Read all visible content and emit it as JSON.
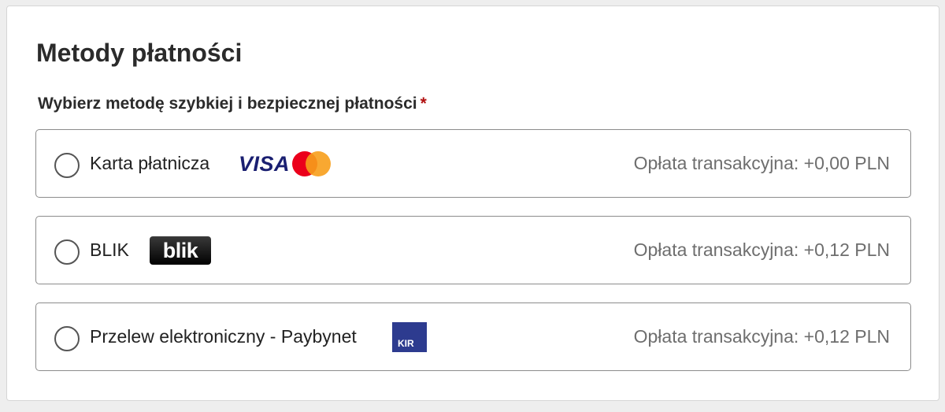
{
  "header": {
    "title": "Metody płatności",
    "subtitle": "Wybierz metodę szybkiej i bezpiecznej płatności",
    "required_mark": "*"
  },
  "options": [
    {
      "label": "Karta płatnicza",
      "fee": "Opłata transakcyjna: +0,00 PLN",
      "logos": {
        "visa": "VISA",
        "mastercard": "mastercard-icon"
      }
    },
    {
      "label": "BLIK",
      "fee": "Opłata transakcyjna: +0,12 PLN",
      "logos": {
        "blik": "blik"
      }
    },
    {
      "label": "Przelew elektroniczny - Paybynet",
      "fee": "Opłata transakcyjna: +0,12 PLN",
      "logos": {
        "kir": "KIR"
      }
    }
  ],
  "colors": {
    "visa": "#1a1f71",
    "mastercard_red": "#eb001b",
    "mastercard_orange": "#f79e1b",
    "kir_blue": "#2d3b8f",
    "required": "#b11010",
    "fee_text": "#6e6e6e"
  }
}
